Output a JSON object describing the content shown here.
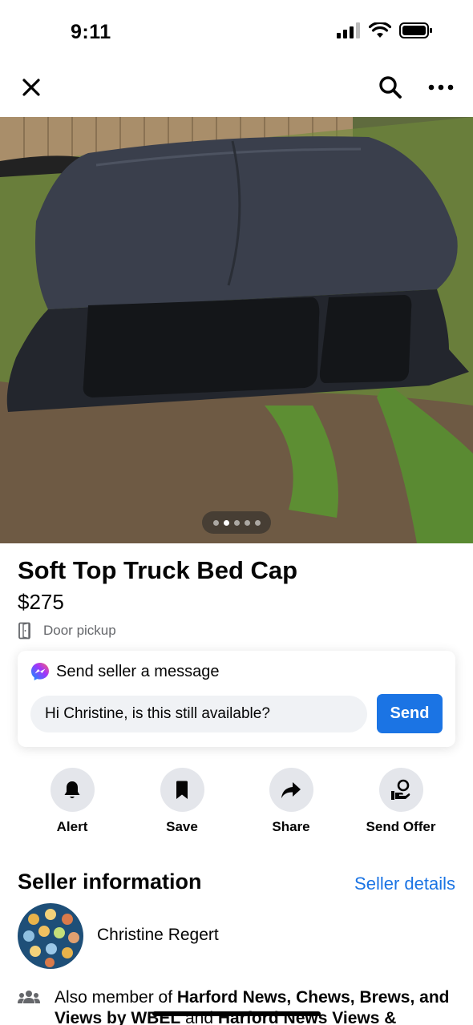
{
  "status_bar": {
    "time": "9:11"
  },
  "nav": {
    "close_icon": "close-icon",
    "search_icon": "search-icon",
    "more_icon": "more-icon"
  },
  "photo": {
    "image_count": 5,
    "active_index": 1
  },
  "listing": {
    "title": "Soft Top Truck Bed Cap",
    "price": "$275",
    "pickup": "Door pickup"
  },
  "message": {
    "header": "Send seller a message",
    "input_value": "Hi Christine, is this still available?",
    "send_label": "Send"
  },
  "actions": [
    {
      "label": "Alert",
      "icon": "bell-icon"
    },
    {
      "label": "Save",
      "icon": "bookmark-icon"
    },
    {
      "label": "Share",
      "icon": "share-arrow-icon"
    },
    {
      "label": "Send Offer",
      "icon": "offer-icon"
    }
  ],
  "seller": {
    "section_title": "Seller information",
    "details_link": "Seller details",
    "name": "Christine Regert",
    "member_prefix": "Also member of ",
    "member_groups": "Harford News, Chews, Brews, and Views by WBEL",
    "member_connector": " and ",
    "member_groups_2": "Harford News Views &"
  },
  "colors": {
    "accent": "#1b74e4",
    "action_bg": "#e4e6eb",
    "input_bg": "#f0f2f5",
    "muted": "#65676b"
  }
}
